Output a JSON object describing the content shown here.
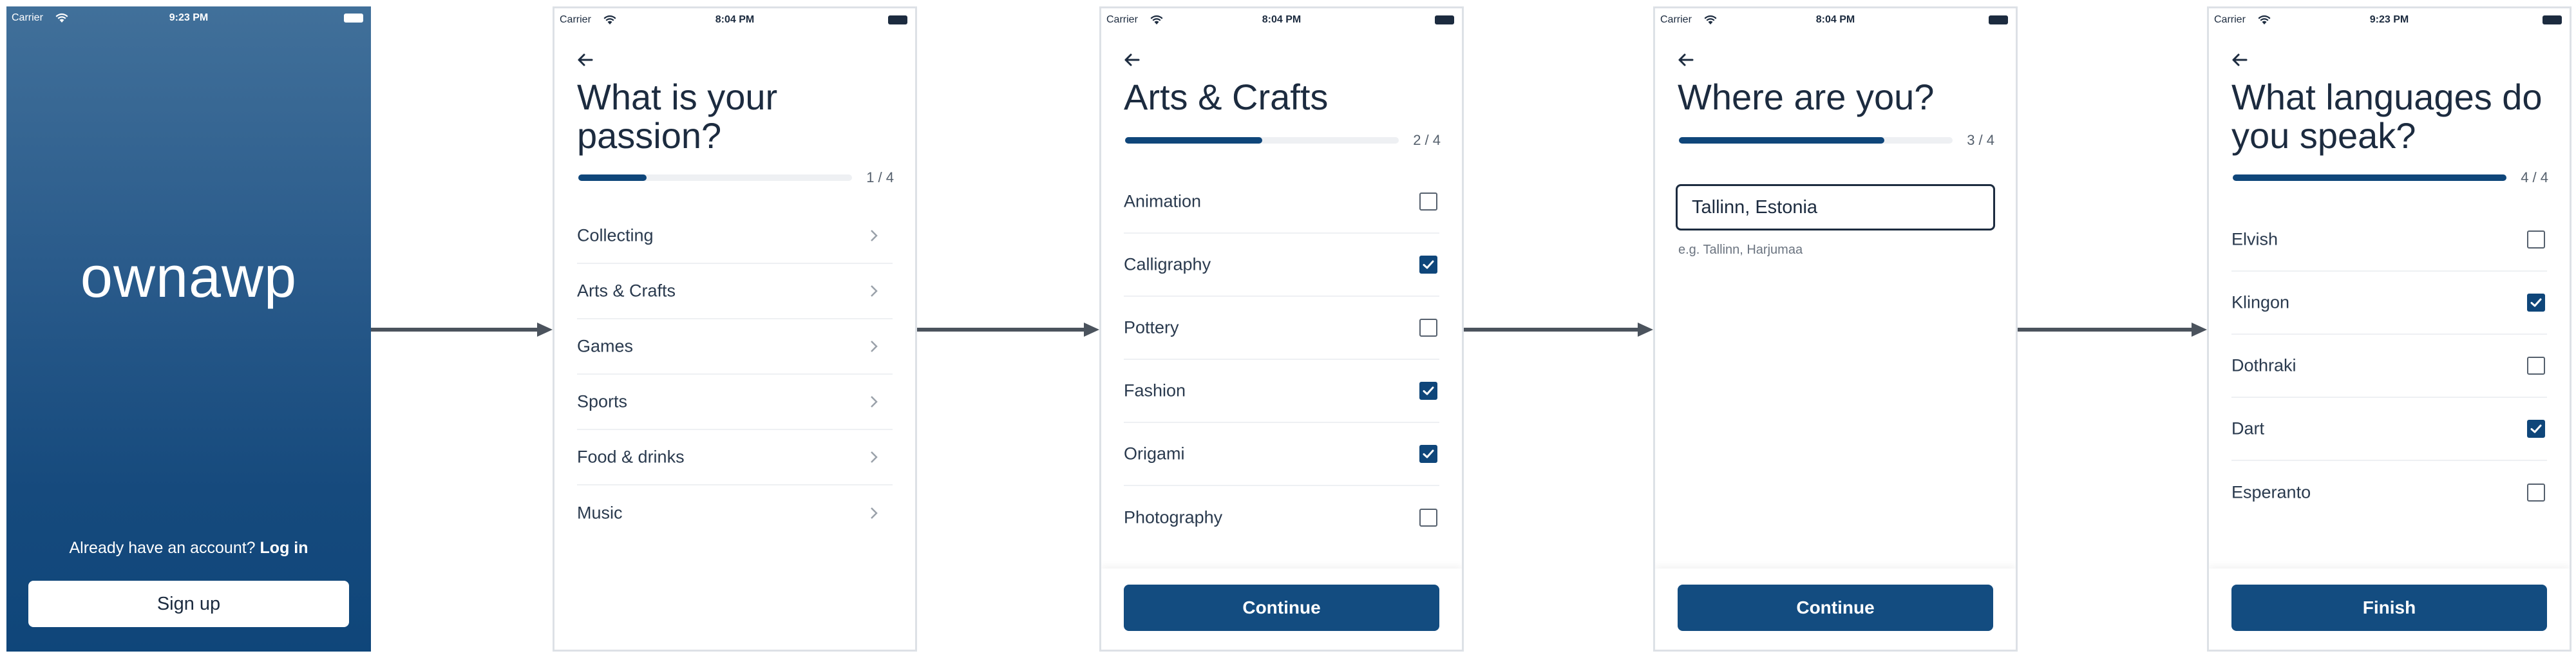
{
  "colors": {
    "primary": "#134c80",
    "gradient_top": "#41709a",
    "gradient_bottom": "#0f467a",
    "text": "#1c2b3f",
    "arrow": "#4b535d"
  },
  "screens": [
    {
      "status": {
        "carrier": "Carrier",
        "time": "9:23 PM"
      },
      "brand": "ownawp",
      "login_prompt": "Already have an account?",
      "login_link": "Log in",
      "signup_label": "Sign up"
    },
    {
      "status": {
        "carrier": "Carrier",
        "time": "8:04 PM"
      },
      "back_icon": "arrow-left-icon",
      "title": "What is your passion?",
      "progress": {
        "label": "1 / 4",
        "fraction": 0.25
      },
      "items": [
        "Collecting",
        "Arts & Crafts",
        "Games",
        "Sports",
        "Food & drinks",
        "Music"
      ]
    },
    {
      "status": {
        "carrier": "Carrier",
        "time": "8:04 PM"
      },
      "back_icon": "arrow-left-icon",
      "title": "Arts & Crafts",
      "progress": {
        "label": "2 / 4",
        "fraction": 0.5
      },
      "items": [
        {
          "label": "Animation",
          "checked": false
        },
        {
          "label": "Calligraphy",
          "checked": true
        },
        {
          "label": "Pottery",
          "checked": false
        },
        {
          "label": "Fashion",
          "checked": true
        },
        {
          "label": "Origami",
          "checked": true
        },
        {
          "label": "Photography",
          "checked": false
        }
      ],
      "button": "Continue"
    },
    {
      "status": {
        "carrier": "Carrier",
        "time": "8:04 PM"
      },
      "back_icon": "arrow-left-icon",
      "title": "Where are you?",
      "progress": {
        "label": "3 / 4",
        "fraction": 0.75
      },
      "location_value": "Tallinn, Estonia",
      "hint": "e.g. Tallinn, Harjumaa",
      "button": "Continue"
    },
    {
      "status": {
        "carrier": "Carrier",
        "time": "9:23 PM"
      },
      "back_icon": "arrow-left-icon",
      "title": "What languages do you speak?",
      "progress": {
        "label": "4 / 4",
        "fraction": 1.0
      },
      "items": [
        {
          "label": "Elvish",
          "checked": false
        },
        {
          "label": "Klingon",
          "checked": true
        },
        {
          "label": "Dothraki",
          "checked": false
        },
        {
          "label": "Dart",
          "checked": true
        },
        {
          "label": "Esperanto",
          "checked": false
        }
      ],
      "button": "Finish"
    }
  ]
}
